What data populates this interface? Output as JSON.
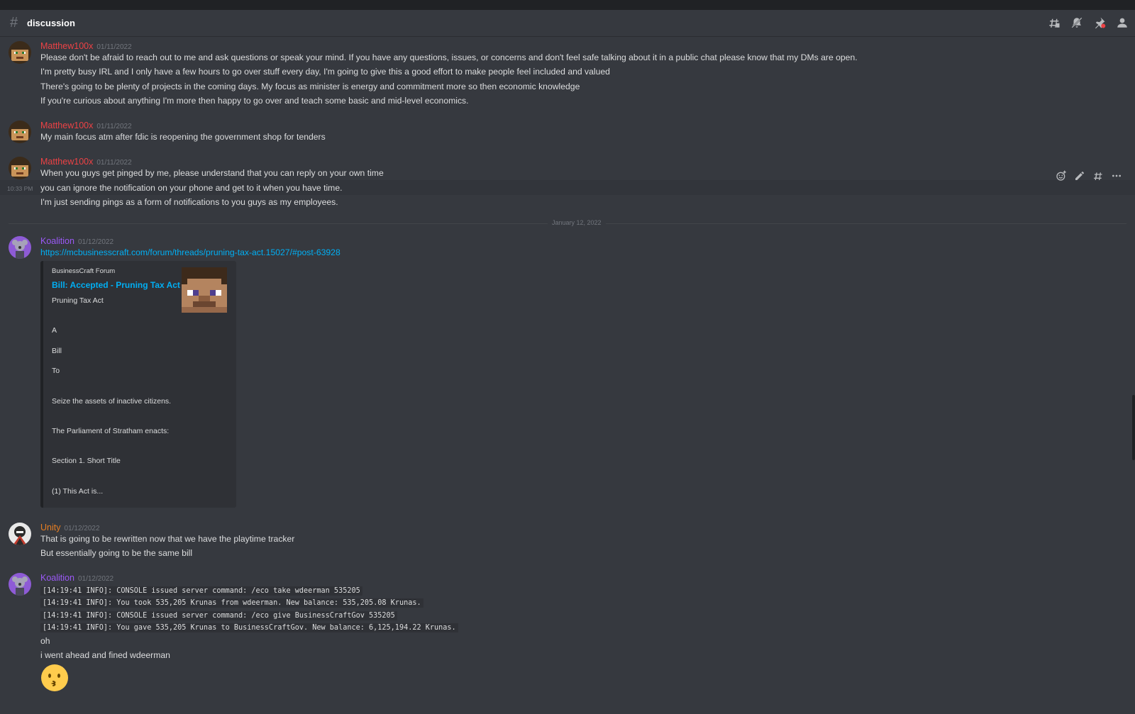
{
  "channel": {
    "name": "discussion"
  },
  "header_icons": [
    "threads-icon",
    "mute-icon",
    "pin-icon",
    "member-list-icon"
  ],
  "colors": {
    "matthew": "#ed4245",
    "koalition": "#9b59f6",
    "unity": "#e67e22",
    "link": "#00aff4"
  },
  "messages": [
    {
      "author": "Matthew100x",
      "date": "01/11/2022",
      "lines": [
        "Please don't be afraid to reach out to me and ask questions or speak your mind. If you have any questions, issues, or concerns and don't feel safe talking about it in a public chat please know that my DMs are open.",
        "I'm pretty busy IRL and I only have a few hours to go over stuff every day, I'm going to give this a good effort to make people feel included and valued",
        "There's going to be plenty of projects in the coming days. My focus as minister is energy and commitment more so then economic knowledge",
        "If you're curious about anything I'm more then happy to go over and teach some basic and mid-level economics."
      ]
    },
    {
      "author": "Matthew100x",
      "date": "01/11/2022",
      "lines": [
        "My main focus atm after fdic is reopening the government shop for tenders"
      ]
    },
    {
      "author": "Matthew100x",
      "date": "01/11/2022",
      "lines": [
        "When you guys get pinged by me, please understand that you can reply on your own time",
        "you can ignore the notification on your phone and get to it when you have time.",
        "I'm just sending pings as a form of notifications to you guys as my employees."
      ],
      "hover_time": "10:33 PM"
    },
    {
      "author": "Koalition",
      "date": "01/12/2022",
      "link": "https://mcbusinesscraft.com/forum/threads/pruning-tax-act.15027/#post-63928",
      "embed": {
        "provider": "BusinessCraft Forum",
        "title": "Bill: Accepted - Pruning Tax Act",
        "description": [
          "Pruning Tax Act",
          "A",
          "Bill",
          "To",
          "Seize the assets of inactive citizens.",
          "The Parliament of Stratham enacts:",
          "Section 1. Short Title",
          "(1) This Act is..."
        ]
      }
    },
    {
      "author": "Unity",
      "date": "01/12/2022",
      "lines": [
        "That is going to be rewritten now that we have the playtime tracker",
        "But essentially going to be the same bill"
      ]
    },
    {
      "author": "Koalition",
      "date": "01/12/2022",
      "code_lines": [
        "[14:19:41 INFO]: CONSOLE issued server command: /eco take wdeerman 535205",
        "[14:19:41 INFO]: You took 535,205 Krunas from wdeerman. New balance: 535,205.08 Krunas.",
        "[14:19:41 INFO]: CONSOLE issued server command: /eco give BusinessCraftGov 535205",
        "[14:19:41 INFO]: You gave 535,205 Krunas to BusinessCraftGov. New balance: 6,125,194.22 Krunas."
      ],
      "lines": [
        "oh",
        "i went ahead and fined wdeerman"
      ],
      "emoji": "kissing-face-emoji"
    }
  ],
  "date_divider": "January 12, 2022",
  "message_actions": [
    "add-reaction-icon",
    "edit-icon",
    "create-thread-icon",
    "more-icon"
  ]
}
